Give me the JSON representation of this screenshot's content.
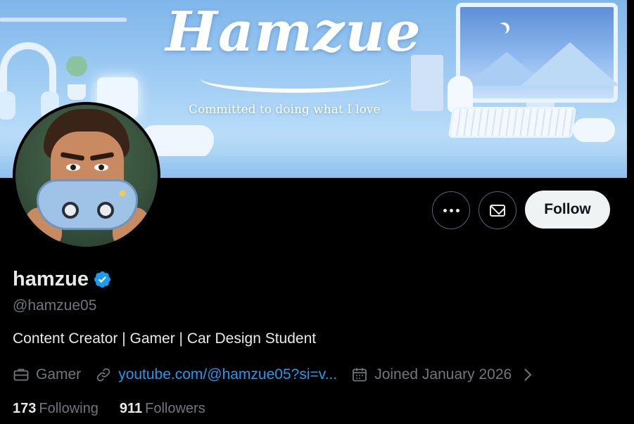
{
  "banner": {
    "title": "Hamzue",
    "tagline": "Committed to doing what I love"
  },
  "profile": {
    "display_name": "hamzue",
    "handle": "@hamzue05",
    "bio": "Content Creator | Gamer | Car Design Student",
    "category": "Gamer",
    "link_text": "youtube.com/@hamzue05?si=v...",
    "joined": "Joined January 2026",
    "verified": true
  },
  "actions": {
    "more_icon": "more-icon",
    "message_icon": "envelope-icon",
    "follow_label": "Follow"
  },
  "stats": {
    "following_count": "173",
    "following_label": "Following",
    "followers_count": "911",
    "followers_label": "Followers"
  },
  "colors": {
    "background": "#000000",
    "text_primary": "#e7e9ea",
    "text_secondary": "#71767b",
    "link": "#1d9bf0",
    "verified_badge": "#1d9bf0",
    "follow_button_bg": "#eff3f4",
    "banner_blue": "#9ccaf3"
  }
}
